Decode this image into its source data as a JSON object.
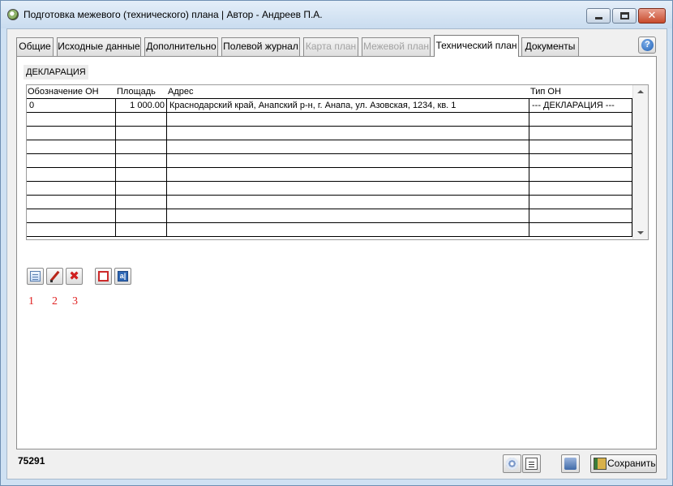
{
  "window": {
    "title": "Подготовка межевого (технического) плана | Автор - Андреев П.А."
  },
  "tabs": [
    {
      "label": "Общие",
      "state": "normal"
    },
    {
      "label": "Исходные данные",
      "state": "normal"
    },
    {
      "label": "Дополнительно",
      "state": "normal"
    },
    {
      "label": "Полевой журнал",
      "state": "normal"
    },
    {
      "label": "Карта план",
      "state": "disabled"
    },
    {
      "label": "Межевой план",
      "state": "disabled"
    },
    {
      "label": "Технический план",
      "state": "active"
    },
    {
      "label": "Документы",
      "state": "normal"
    }
  ],
  "section_label": "ДЕКЛАРАЦИЯ",
  "table": {
    "columns": [
      "Обозначение ОН",
      "Площадь",
      "Адрес",
      "Тип ОН"
    ],
    "rows": [
      [
        "0",
        "1 000.00",
        "Краснодарский край, Анапский р-н, г. Анапа, ул. Азовская, 1234, кв. 1",
        "--- ДЕКЛАРАЦИЯ ---"
      ],
      [
        "",
        "",
        "",
        ""
      ],
      [
        "",
        "",
        "",
        ""
      ],
      [
        "",
        "",
        "",
        ""
      ],
      [
        "",
        "",
        "",
        ""
      ],
      [
        "",
        "",
        "",
        ""
      ],
      [
        "",
        "",
        "",
        ""
      ],
      [
        "",
        "",
        "",
        ""
      ],
      [
        "",
        "",
        "",
        ""
      ],
      [
        "",
        "",
        "",
        ""
      ]
    ]
  },
  "toolbar": {
    "icons": [
      "new-document-icon",
      "edit-pencil-icon",
      "delete-x-icon",
      "red-square-icon",
      "blue-ab-icon"
    ]
  },
  "annotations": [
    "1",
    "2",
    "3"
  ],
  "footer": {
    "record_id": "75291",
    "save_label": "Сохранить"
  },
  "colors": {
    "window_frame": "#cfe1f3",
    "annotation_red": "#e02222"
  }
}
